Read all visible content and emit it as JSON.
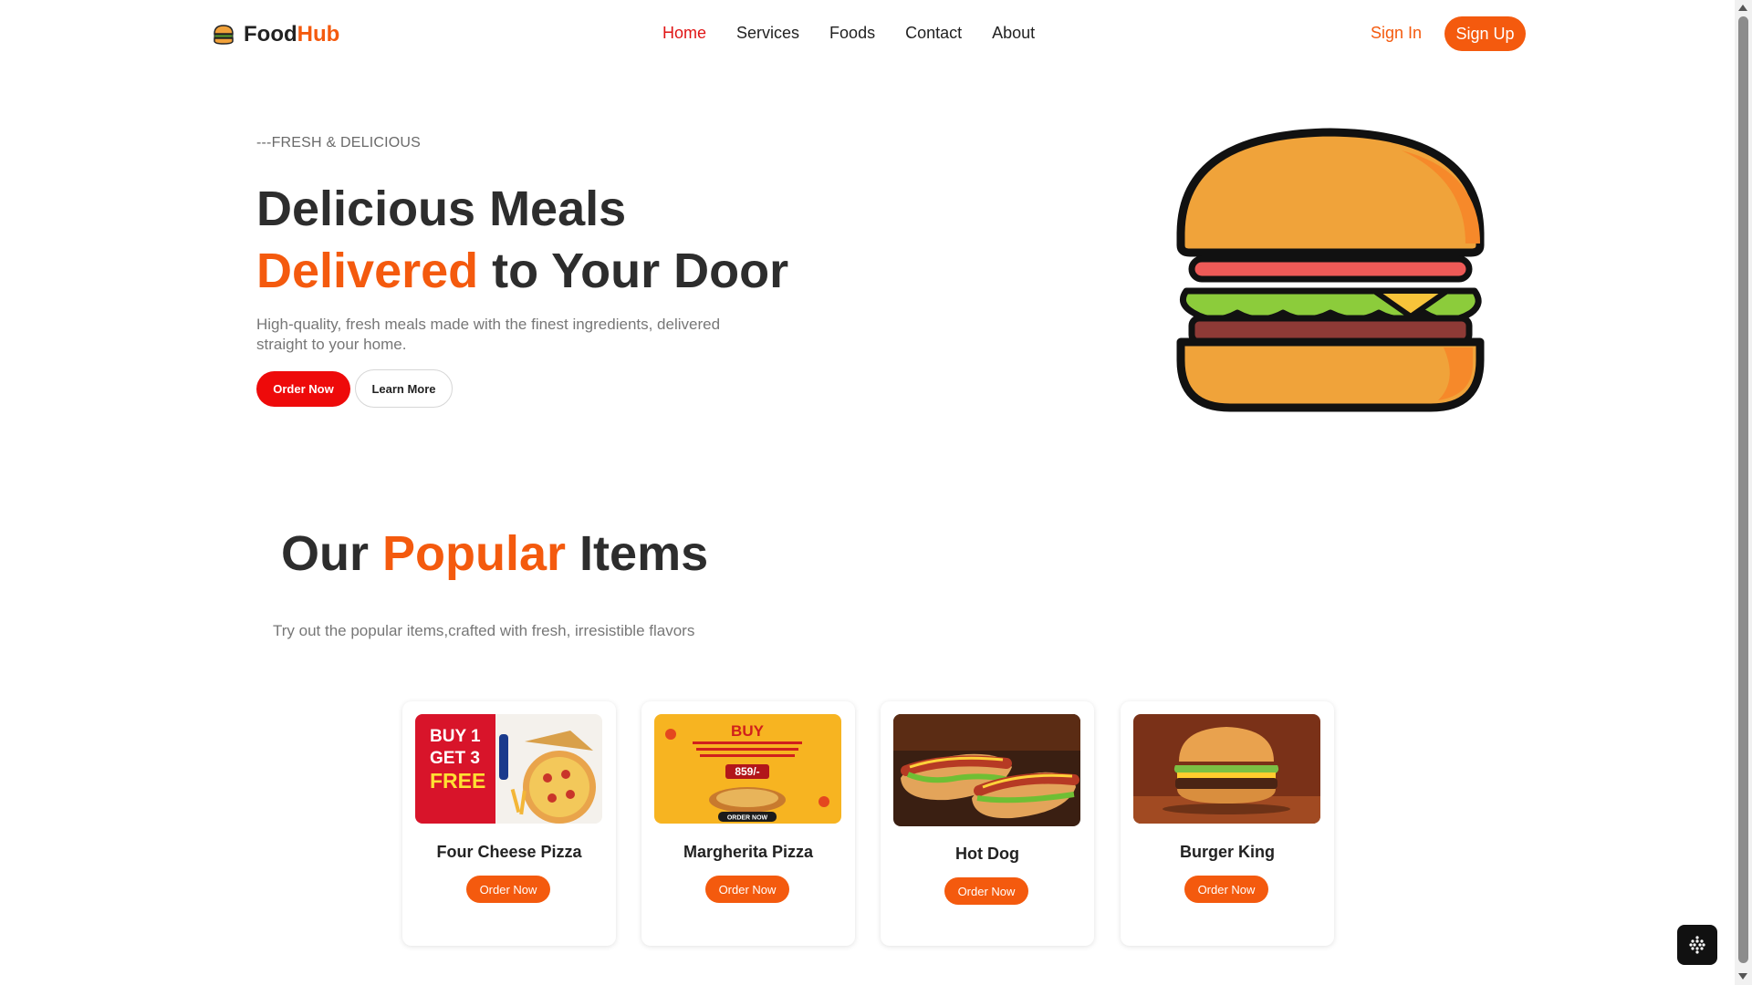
{
  "brand": {
    "name_part1": "Food",
    "name_part2": "Hub",
    "icon": "burger-icon"
  },
  "nav": {
    "items": [
      {
        "label": "Home",
        "active": true
      },
      {
        "label": "Services",
        "active": false
      },
      {
        "label": "Foods",
        "active": false
      },
      {
        "label": "Contact",
        "active": false
      },
      {
        "label": "About",
        "active": false
      }
    ],
    "sign_in": "Sign In",
    "sign_up": "Sign Up"
  },
  "hero": {
    "kicker": "---FRESH & DELICIOUS",
    "title_line1": "Delicious Meals",
    "title_accent": "Delivered",
    "title_rest": " to Your Door",
    "description": "High-quality, fresh meals made with the finest ingredients, delivered straight to your home.",
    "order_button": "Order Now",
    "learn_button": "Learn More",
    "image_icon": "burger-illustration"
  },
  "popular": {
    "title_part1": "Our ",
    "title_accent": "Popular",
    "title_part2": " Items",
    "subtitle": "Try out the popular items,crafted with fresh, irresistible flavors",
    "items": [
      {
        "name": "Four Cheese Pizza",
        "button": "Order Now",
        "promo_line1": "BUY 1",
        "promo_line2": "GET 3",
        "promo_line3": "FREE"
      },
      {
        "name": "Margherita Pizza",
        "button": "Order Now",
        "promo_title": "BUY",
        "promo_price": "859/-",
        "promo_cta": "ORDER NOW"
      },
      {
        "name": "Hot Dog",
        "button": "Order Now"
      },
      {
        "name": "Burger King",
        "button": "Order Now"
      }
    ]
  },
  "colors": {
    "accent": "#f45a0e",
    "red": "#ee0a0a",
    "text": "#2d2d2d",
    "muted": "#777777"
  }
}
